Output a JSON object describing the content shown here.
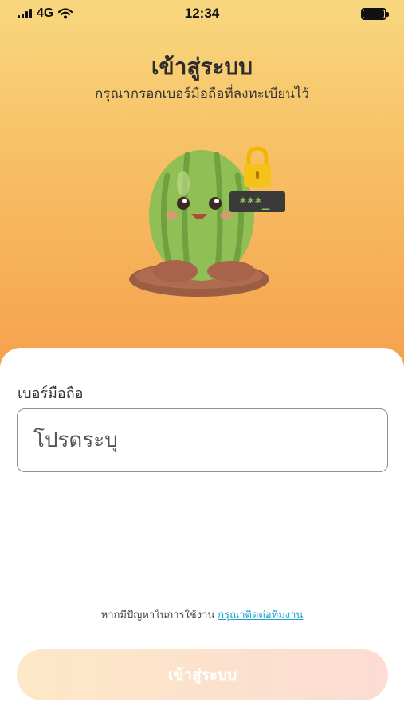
{
  "status_bar": {
    "network": "4G",
    "time": "12:34"
  },
  "header": {
    "title": "เข้าสู่ระบบ",
    "subtitle": "กรุณากรอกเบอร์มือถือที่ลงทะเบียนไว้"
  },
  "illustration": {
    "screen_text": "***_"
  },
  "form": {
    "phone_label": "เบอร์มือถือ",
    "phone_placeholder": "โปรดระบุ",
    "phone_value": ""
  },
  "help": {
    "text": "หากมีปัญหาในการใช้งาน",
    "link_text": "กรุณาติดต่อทีมงาน"
  },
  "actions": {
    "login_label": "เข้าสู่ระบบ"
  },
  "colors": {
    "gradient_top": "#f8d77f",
    "gradient_bottom": "#f6a04c",
    "link": "#1aa3c8",
    "button_disabled": "#fde8c7"
  },
  "icons": [
    "signal-icon",
    "wifi-icon",
    "battery-icon",
    "padlock-icon"
  ]
}
